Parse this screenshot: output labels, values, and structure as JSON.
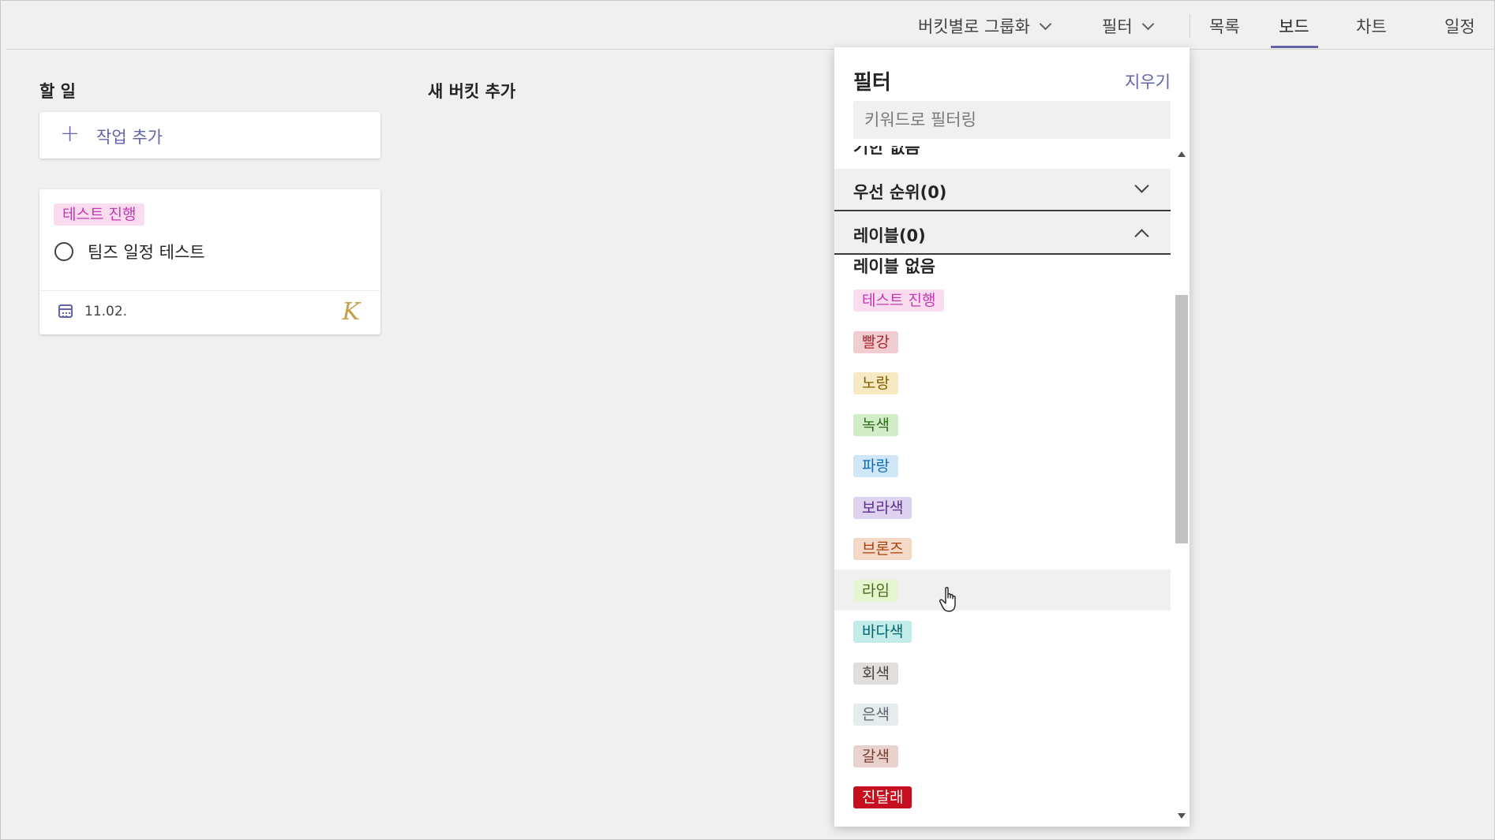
{
  "toolbar": {
    "group_by_label": "버킷별로 그룹화",
    "filter_label": "필터",
    "tabs": [
      "목록",
      "보드",
      "차트",
      "일정"
    ],
    "active_tab": "보드"
  },
  "board": {
    "buckets": [
      {
        "title": "할 일",
        "add_task_label": "작업 추가"
      },
      {
        "title": "새 버킷 추가"
      }
    ],
    "task": {
      "label": "테스트 진행",
      "title": "팀즈 일정 테스트",
      "due_date": "11.02.",
      "avatar_initial": "K"
    }
  },
  "filter_panel": {
    "title": "필터",
    "clear_label": "지우기",
    "search_placeholder": "키워드로 필터링",
    "cut_off_item": "기한 없음",
    "sections": [
      {
        "label": "우선 순위(0)",
        "expanded": false
      },
      {
        "label": "레이블(0)",
        "expanded": true
      }
    ],
    "no_label_text": "레이블 없음",
    "labels": [
      {
        "name": "테스트 진행",
        "bg": "#fadcef",
        "fg": "#c239b3"
      },
      {
        "name": "빨강",
        "bg": "#f1cdd1",
        "fg": "#a4262c"
      },
      {
        "name": "노랑",
        "bg": "#f7eac2",
        "fg": "#835c00"
      },
      {
        "name": "녹색",
        "bg": "#d3ecc8",
        "fg": "#2f6b1f"
      },
      {
        "name": "파랑",
        "bg": "#d0e7f8",
        "fg": "#0f6cbd"
      },
      {
        "name": "보라색",
        "bg": "#ddd3ee",
        "fg": "#5c2e91"
      },
      {
        "name": "브론즈",
        "bg": "#f4d8c8",
        "fg": "#a74109"
      },
      {
        "name": "라임",
        "bg": "#e5f5d0",
        "fg": "#4b6d1b"
      },
      {
        "name": "바다색",
        "bg": "#c2ecea",
        "fg": "#00666d"
      },
      {
        "name": "회색",
        "bg": "#e1dfdd",
        "fg": "#484644"
      },
      {
        "name": "은색",
        "bg": "#e6ebed",
        "fg": "#5c6870"
      },
      {
        "name": "갈색",
        "bg": "#ead2cc",
        "fg": "#7a3f33"
      },
      {
        "name": "진달래",
        "bg": "#c50f1f",
        "fg": "#ffffff"
      }
    ],
    "hovered_label": "라임"
  }
}
